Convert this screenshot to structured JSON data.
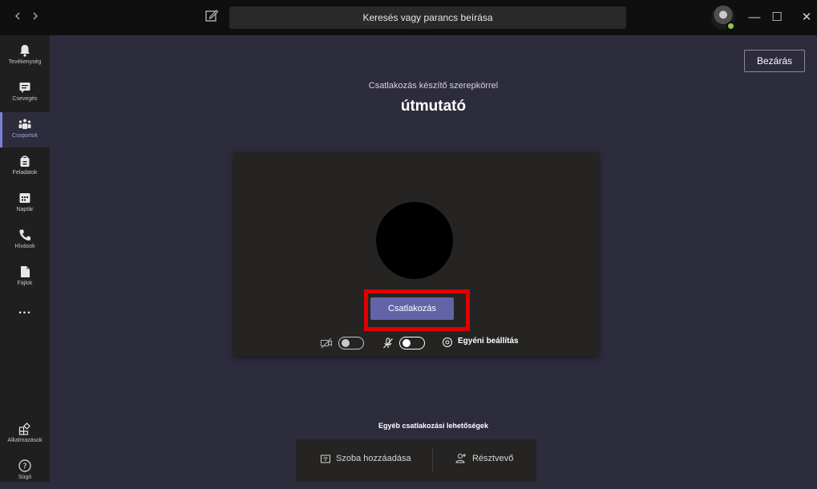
{
  "titlebar": {
    "back_icon": "chevron-left-icon",
    "forward_icon": "chevron-right-icon",
    "compose_icon": "compose-icon",
    "search_placeholder": "Keresés vagy parancs beírása",
    "minimize": "—",
    "maximize": "☐",
    "close": "✕"
  },
  "rail": {
    "items": [
      {
        "label": "Tevékenység",
        "icon": "bell-icon"
      },
      {
        "label": "Csevegés",
        "icon": "chat-icon"
      },
      {
        "label": "Csoportok",
        "icon": "teams-icon",
        "active": true
      },
      {
        "label": "Feladatok",
        "icon": "assignments-icon"
      },
      {
        "label": "Naptár",
        "icon": "calendar-icon"
      },
      {
        "label": "Hívások",
        "icon": "phone-icon"
      },
      {
        "label": "Fájlok",
        "icon": "file-icon"
      },
      {
        "label": "...",
        "icon": "more-icon"
      }
    ],
    "apps_label": "Alkalmazások",
    "help_label": "Súgó"
  },
  "main": {
    "close_label": "Bezárás",
    "subtitle": "Csatlakozás készítő szerepkörrel",
    "title": "útmutató",
    "join_label": "Csatlakozás",
    "custom_setting_label": "Egyéni beállítás",
    "video_on": false,
    "mic_on": true,
    "other_options_label": "Egyéb csatlakozási lehetőségek",
    "add_room_label": "Szoba hozzáadása",
    "participant_label": "Résztvevő"
  },
  "colors": {
    "accent": "#6264a7",
    "highlight": "#e00000",
    "background": "#2d2c3c",
    "rail": "#1f1f1f",
    "titlebar": "#0f0f0f"
  }
}
